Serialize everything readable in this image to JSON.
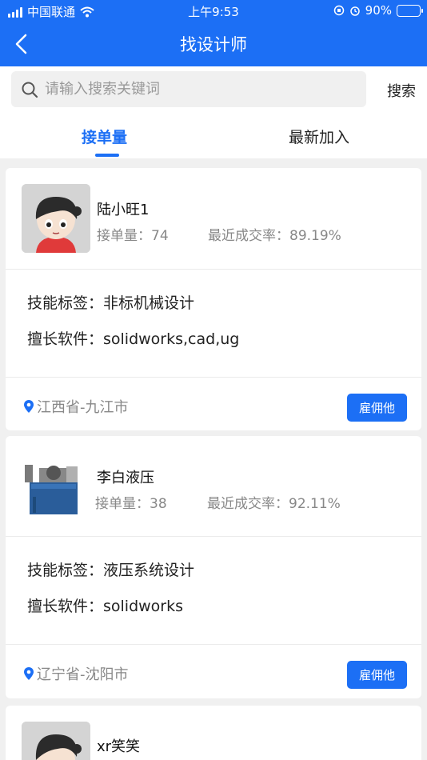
{
  "status": {
    "carrier": "中国联通",
    "time": "上午9:53",
    "battery": "90%"
  },
  "nav": {
    "title": "找设计师"
  },
  "search": {
    "placeholder": "请输入搜索关键词",
    "button": "搜索"
  },
  "tabs": [
    {
      "label": "接单量"
    },
    {
      "label": "最新加入"
    }
  ],
  "colors": {
    "brand": "#1c6ff5"
  },
  "designers": [
    {
      "name": "陆小旺1",
      "orders": "接单量：74",
      "rate": "最近成交率：89.19%",
      "skills": "技能标签：非标机械设计",
      "software": "擅长软件：solidworks,cad,ug",
      "location": "江西省-九江市",
      "hire": "雇佣他"
    },
    {
      "name": "李白液压",
      "orders": "接单量：38",
      "rate": "最近成交率：92.11%",
      "skills": "技能标签：液压系统设计",
      "software": "擅长软件：solidworks",
      "location": "辽宁省-沈阳市",
      "hire": "雇佣他"
    },
    {
      "name": "xr笑笑"
    }
  ]
}
